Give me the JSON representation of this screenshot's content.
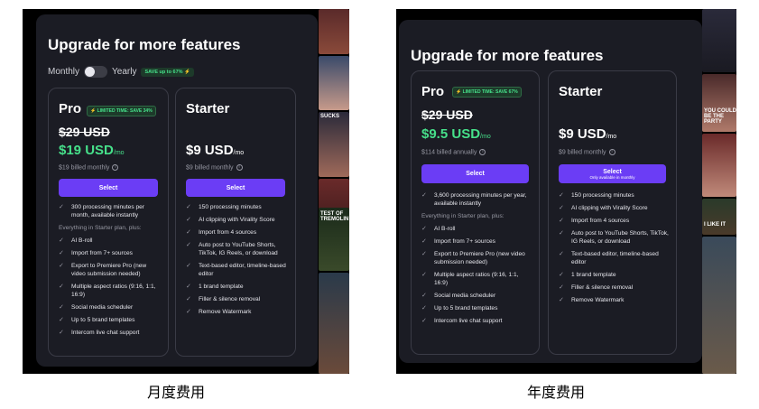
{
  "monthly_panel": {
    "title": "Upgrade for more features",
    "toggle": {
      "monthly_label": "Monthly",
      "yearly_label": "Yearly",
      "save_badge": "SAVE up to 67% ⚡"
    },
    "pro": {
      "name": "Pro",
      "badge": "⚡ LIMITED TIME: SAVE 34%",
      "old_price": "$29 USD",
      "price": "$19 USD",
      "unit": "/mo",
      "billed": "$19 billed monthly",
      "button": "Select",
      "features": [
        {
          "text": "300 processing minutes per month, available instantly",
          "check": true
        },
        {
          "text": "Everything in Starter plan, plus:",
          "check": false
        },
        {
          "text": "AI B-roll",
          "check": true
        },
        {
          "text": "Import from 7+ sources",
          "check": true
        },
        {
          "text": "Export to Premiere Pro (new video submission needed)",
          "check": true
        },
        {
          "text": "Multiple aspect ratios (9:16, 1:1, 16:9)",
          "check": true
        },
        {
          "text": "Social media scheduler",
          "check": true
        },
        {
          "text": "Up to 5 brand templates",
          "check": true
        },
        {
          "text": "Intercom live chat support",
          "check": true
        }
      ]
    },
    "starter": {
      "name": "Starter",
      "price": "$9 USD",
      "unit": "/mo",
      "billed": "$9 billed monthly",
      "button": "Select",
      "features": [
        {
          "text": "150 processing minutes",
          "check": true
        },
        {
          "text": "AI clipping with Virality Score",
          "check": true
        },
        {
          "text": "Import from 4 sources",
          "check": true
        },
        {
          "text": "Auto post to YouTube Shorts, TikTok, IG Reels, or download",
          "check": true
        },
        {
          "text": "Text-based editor, timeline-based editor",
          "check": true
        },
        {
          "text": "1 brand template",
          "check": true
        },
        {
          "text": "Filler & silence removal",
          "check": true
        },
        {
          "text": "Remove Watermark",
          "check": true
        }
      ]
    }
  },
  "yearly_panel": {
    "title": "Upgrade for more features",
    "pro": {
      "name": "Pro",
      "badge": "⚡ LIMITED TIME: SAVE 67%",
      "old_price": "$29 USD",
      "price": "$9.5 USD",
      "unit": "/mo",
      "billed": "$114 billed annually",
      "button": "Select",
      "features": [
        {
          "text": "3,600 processing minutes per year, available instantly",
          "check": true
        },
        {
          "text": "Everything in Starter plan, plus:",
          "check": false
        },
        {
          "text": "AI B-roll",
          "check": true
        },
        {
          "text": "Import from 7+ sources",
          "check": true
        },
        {
          "text": "Export to Premiere Pro (new video submission needed)",
          "check": true
        },
        {
          "text": "Multiple aspect ratios (9:16, 1:1, 16:9)",
          "check": true
        },
        {
          "text": "Social media scheduler",
          "check": true
        },
        {
          "text": "Up to 5 brand templates",
          "check": true
        },
        {
          "text": "Intercom live chat support",
          "check": true
        }
      ]
    },
    "starter": {
      "name": "Starter",
      "price": "$9 USD",
      "unit": "/mo",
      "billed": "$9 billed monthly",
      "button": "Select",
      "button_sub": "Only available in monthly",
      "features": [
        {
          "text": "150 processing minutes",
          "check": true
        },
        {
          "text": "AI clipping with Virality Score",
          "check": true
        },
        {
          "text": "Import from 4 sources",
          "check": true
        },
        {
          "text": "Auto post to YouTube Shorts, TikTok, IG Reels, or download",
          "check": true
        },
        {
          "text": "Text-based editor, timeline-based editor",
          "check": true
        },
        {
          "text": "1 brand template",
          "check": true
        },
        {
          "text": "Filler & silence removal",
          "check": true
        },
        {
          "text": "Remove Watermark",
          "check": true
        }
      ]
    }
  },
  "video_overlays": {
    "sucks": "SUCKS",
    "tretest": "TEST OF TREMOLIN",
    "you_could": "YOU COULD BE THE PARTY",
    "i_like": "I LIKE IT"
  },
  "captions": {
    "monthly": "月度费用",
    "yearly": "年度费用"
  },
  "colors": {
    "accent": "#6b3df5",
    "price_green": "#46e08a",
    "card_bg": "#1b1c24"
  },
  "icons": {
    "check": "check-icon",
    "info": "info-icon",
    "bolt": "lightning-icon"
  }
}
